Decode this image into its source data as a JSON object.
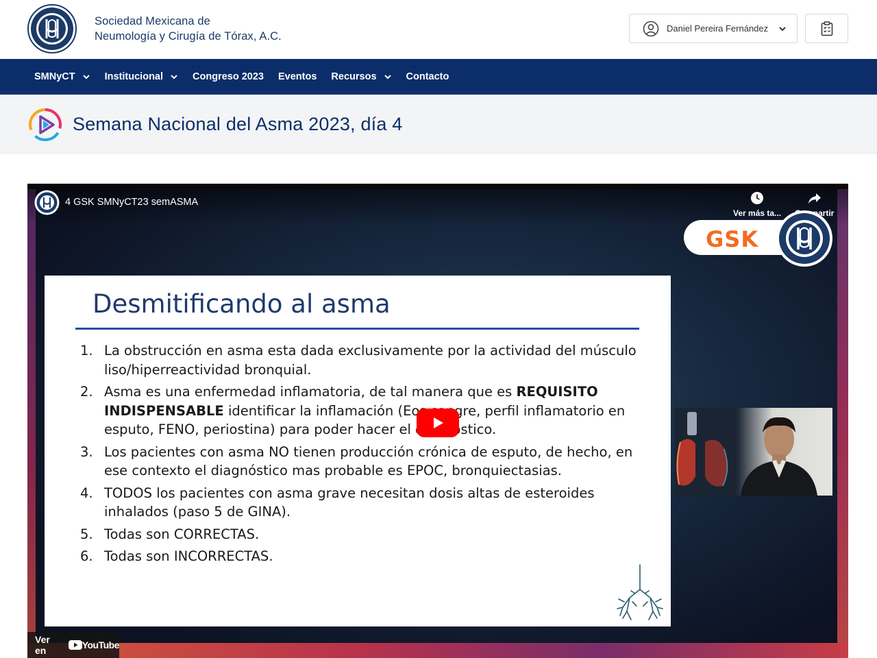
{
  "header": {
    "org_line1": "Sociedad Mexicana de",
    "org_line2": "Neumología y Cirugía de Tórax, A.C.",
    "user_name": "Daniel Pereira Fernández"
  },
  "nav": {
    "items": [
      {
        "label": "SMNyCT",
        "dropdown": true
      },
      {
        "label": "Institucional",
        "dropdown": true
      },
      {
        "label": "Congreso 2023",
        "dropdown": false
      },
      {
        "label": "Eventos",
        "dropdown": false
      },
      {
        "label": "Recursos",
        "dropdown": true
      },
      {
        "label": "Contacto",
        "dropdown": false
      }
    ]
  },
  "page": {
    "title": "Semana Nacional del Asma 2023, día 4"
  },
  "video": {
    "title": "4 GSK SMNyCT23 semASMA",
    "watch_later_label": "Ver más ta...",
    "share_label": "Compartir",
    "sponsor": "GSK",
    "watch_on_label": "Ver en",
    "youtube_label": "YouTube",
    "slide": {
      "title": "Desmitificando al asma",
      "items": [
        {
          "num": "1.",
          "html": "La obstrucción en asma esta dada exclusivamente por la actividad del músculo liso/hiperreactividad bronquial."
        },
        {
          "num": "2.",
          "html": "Asma es una enfermedad inflamatoria, de tal manera que es <b>REQUISITO INDISPENSABLE</b> identificar la inflamación (Eos sangre, perfil inflamatorio en esputo, FENO, periostina) para poder hacer el diagnóstico."
        },
        {
          "num": "3.",
          "html": "Los pacientes con asma NO tienen producción crónica de esputo, de hecho, en ese contexto el diagnóstico mas probable es EPOC, bronquiectasias."
        },
        {
          "num": "4.",
          "html": "TODOS los pacientes con asma grave necesitan dosis altas de esteroides inhalados (paso 5 de GINA)."
        },
        {
          "num": "5.",
          "html": "Todas son CORRECTAS."
        },
        {
          "num": "6.",
          "html": "Todas son INCORRECTAS."
        }
      ]
    }
  },
  "colors": {
    "navy": "#0b2e6b",
    "gsk_orange": "#f36c21",
    "youtube_red": "#ff0000"
  }
}
